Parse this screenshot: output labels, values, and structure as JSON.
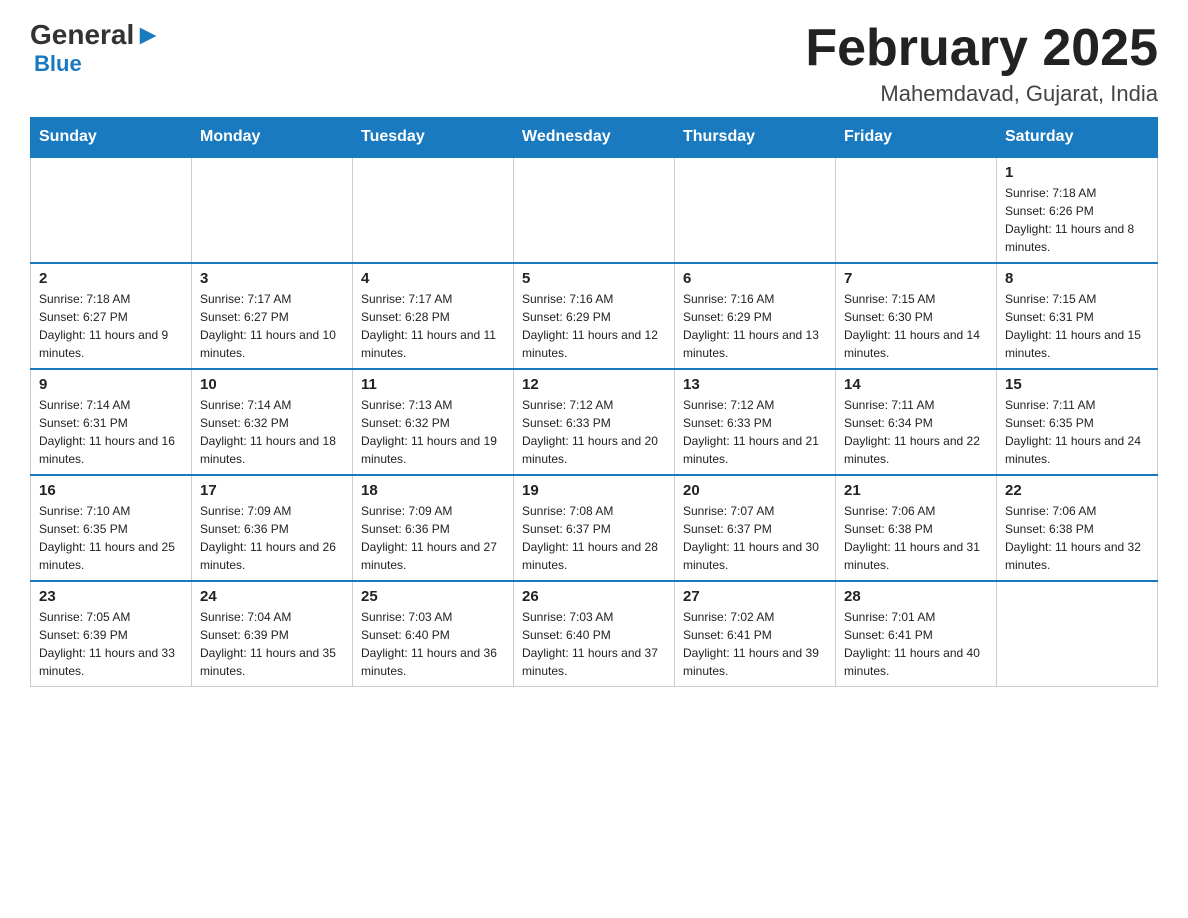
{
  "header": {
    "logo_general": "General",
    "logo_blue": "Blue",
    "month_year": "February 2025",
    "location": "Mahemdavad, Gujarat, India"
  },
  "days_of_week": [
    "Sunday",
    "Monday",
    "Tuesday",
    "Wednesday",
    "Thursday",
    "Friday",
    "Saturday"
  ],
  "weeks": [
    [
      {
        "day": "",
        "info": ""
      },
      {
        "day": "",
        "info": ""
      },
      {
        "day": "",
        "info": ""
      },
      {
        "day": "",
        "info": ""
      },
      {
        "day": "",
        "info": ""
      },
      {
        "day": "",
        "info": ""
      },
      {
        "day": "1",
        "info": "Sunrise: 7:18 AM\nSunset: 6:26 PM\nDaylight: 11 hours and 8 minutes."
      }
    ],
    [
      {
        "day": "2",
        "info": "Sunrise: 7:18 AM\nSunset: 6:27 PM\nDaylight: 11 hours and 9 minutes."
      },
      {
        "day": "3",
        "info": "Sunrise: 7:17 AM\nSunset: 6:27 PM\nDaylight: 11 hours and 10 minutes."
      },
      {
        "day": "4",
        "info": "Sunrise: 7:17 AM\nSunset: 6:28 PM\nDaylight: 11 hours and 11 minutes."
      },
      {
        "day": "5",
        "info": "Sunrise: 7:16 AM\nSunset: 6:29 PM\nDaylight: 11 hours and 12 minutes."
      },
      {
        "day": "6",
        "info": "Sunrise: 7:16 AM\nSunset: 6:29 PM\nDaylight: 11 hours and 13 minutes."
      },
      {
        "day": "7",
        "info": "Sunrise: 7:15 AM\nSunset: 6:30 PM\nDaylight: 11 hours and 14 minutes."
      },
      {
        "day": "8",
        "info": "Sunrise: 7:15 AM\nSunset: 6:31 PM\nDaylight: 11 hours and 15 minutes."
      }
    ],
    [
      {
        "day": "9",
        "info": "Sunrise: 7:14 AM\nSunset: 6:31 PM\nDaylight: 11 hours and 16 minutes."
      },
      {
        "day": "10",
        "info": "Sunrise: 7:14 AM\nSunset: 6:32 PM\nDaylight: 11 hours and 18 minutes."
      },
      {
        "day": "11",
        "info": "Sunrise: 7:13 AM\nSunset: 6:32 PM\nDaylight: 11 hours and 19 minutes."
      },
      {
        "day": "12",
        "info": "Sunrise: 7:12 AM\nSunset: 6:33 PM\nDaylight: 11 hours and 20 minutes."
      },
      {
        "day": "13",
        "info": "Sunrise: 7:12 AM\nSunset: 6:33 PM\nDaylight: 11 hours and 21 minutes."
      },
      {
        "day": "14",
        "info": "Sunrise: 7:11 AM\nSunset: 6:34 PM\nDaylight: 11 hours and 22 minutes."
      },
      {
        "day": "15",
        "info": "Sunrise: 7:11 AM\nSunset: 6:35 PM\nDaylight: 11 hours and 24 minutes."
      }
    ],
    [
      {
        "day": "16",
        "info": "Sunrise: 7:10 AM\nSunset: 6:35 PM\nDaylight: 11 hours and 25 minutes."
      },
      {
        "day": "17",
        "info": "Sunrise: 7:09 AM\nSunset: 6:36 PM\nDaylight: 11 hours and 26 minutes."
      },
      {
        "day": "18",
        "info": "Sunrise: 7:09 AM\nSunset: 6:36 PM\nDaylight: 11 hours and 27 minutes."
      },
      {
        "day": "19",
        "info": "Sunrise: 7:08 AM\nSunset: 6:37 PM\nDaylight: 11 hours and 28 minutes."
      },
      {
        "day": "20",
        "info": "Sunrise: 7:07 AM\nSunset: 6:37 PM\nDaylight: 11 hours and 30 minutes."
      },
      {
        "day": "21",
        "info": "Sunrise: 7:06 AM\nSunset: 6:38 PM\nDaylight: 11 hours and 31 minutes."
      },
      {
        "day": "22",
        "info": "Sunrise: 7:06 AM\nSunset: 6:38 PM\nDaylight: 11 hours and 32 minutes."
      }
    ],
    [
      {
        "day": "23",
        "info": "Sunrise: 7:05 AM\nSunset: 6:39 PM\nDaylight: 11 hours and 33 minutes."
      },
      {
        "day": "24",
        "info": "Sunrise: 7:04 AM\nSunset: 6:39 PM\nDaylight: 11 hours and 35 minutes."
      },
      {
        "day": "25",
        "info": "Sunrise: 7:03 AM\nSunset: 6:40 PM\nDaylight: 11 hours and 36 minutes."
      },
      {
        "day": "26",
        "info": "Sunrise: 7:03 AM\nSunset: 6:40 PM\nDaylight: 11 hours and 37 minutes."
      },
      {
        "day": "27",
        "info": "Sunrise: 7:02 AM\nSunset: 6:41 PM\nDaylight: 11 hours and 39 minutes."
      },
      {
        "day": "28",
        "info": "Sunrise: 7:01 AM\nSunset: 6:41 PM\nDaylight: 11 hours and 40 minutes."
      },
      {
        "day": "",
        "info": ""
      }
    ]
  ]
}
